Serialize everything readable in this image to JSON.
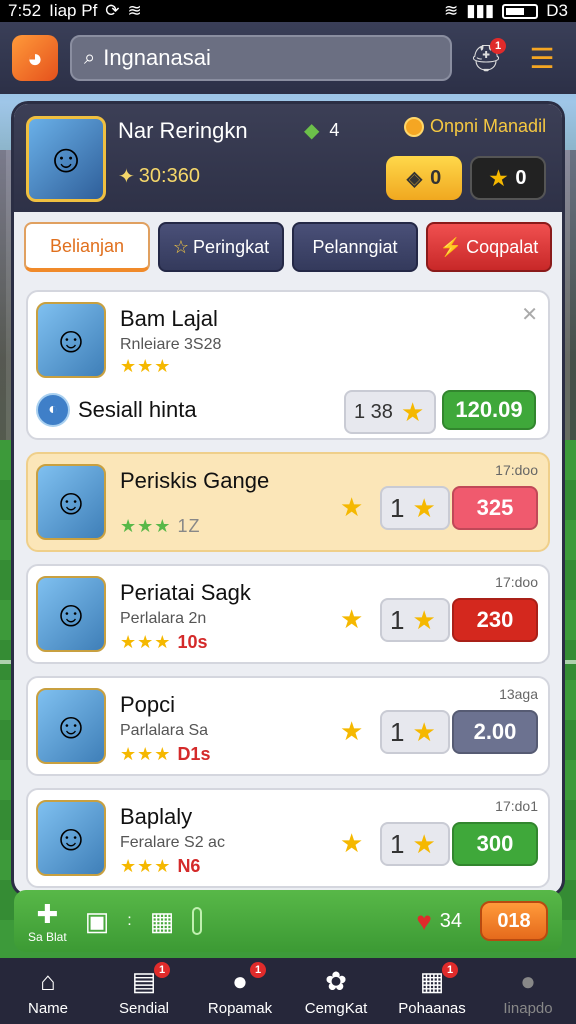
{
  "status": {
    "time": "7:52",
    "carrier": "Iiap Pf",
    "battery": "D3"
  },
  "appbar": {
    "search_text": "Ingnanasai",
    "notif_count": "1"
  },
  "profile": {
    "name": "Nar Reringkn",
    "level": "4",
    "coin_label": "Onpni Manadil",
    "timer": "30:360",
    "gold_pill": "0",
    "star_pill": "0"
  },
  "tabs": [
    {
      "label": "Belianjan"
    },
    {
      "label": "Peringkat"
    },
    {
      "label": "Pelanngiat"
    },
    {
      "label": "Coqpalat"
    }
  ],
  "cards": [
    {
      "name": "Bam Lajal",
      "sub": "Rnleiare 3S28",
      "stars": "★★★",
      "special_label": "Sesiall hinta",
      "count": "1 38",
      "price": "120.09",
      "price_color": "#3fa83a"
    },
    {
      "name": "Periskis Gange",
      "time": "17:doo",
      "stars": "★★★",
      "stars_extra": "1Z",
      "count": "1",
      "price": "325",
      "price_color": "#f05a6e"
    },
    {
      "name": "Periatai Sagk",
      "sub": "Perlalara 2n",
      "time": "17:doo",
      "stars": "★★★",
      "stars_extra": "10s",
      "count": "1",
      "price": "230",
      "price_color": "#d4281e"
    },
    {
      "name": "Popci",
      "sub": "Parlalara Sa",
      "time": "13aga",
      "stars": "★★★",
      "stars_extra": "D1s",
      "count": "1",
      "price": "2.00",
      "price_color": "#6c7290"
    },
    {
      "name": "Baplaly",
      "sub": "Feralare S2 ac",
      "time": "17:do1",
      "stars": "★★★",
      "stars_extra": "N6",
      "count": "1",
      "price": "300",
      "price_color": "#3fa83a"
    }
  ],
  "actionbar": {
    "left_label": "Sa Blat",
    "score": "34",
    "button": "018"
  },
  "bottomnav": [
    {
      "label": "Name",
      "icon": "home-icon"
    },
    {
      "label": "Sendial",
      "icon": "cards-icon"
    },
    {
      "label": "Ropamak",
      "icon": "chat-icon"
    },
    {
      "label": "CemgKat",
      "icon": "gear-icon"
    },
    {
      "label": "Pohaanas",
      "icon": "grid-icon"
    },
    {
      "label": "Iinapdo",
      "icon": "profile-icon"
    }
  ]
}
